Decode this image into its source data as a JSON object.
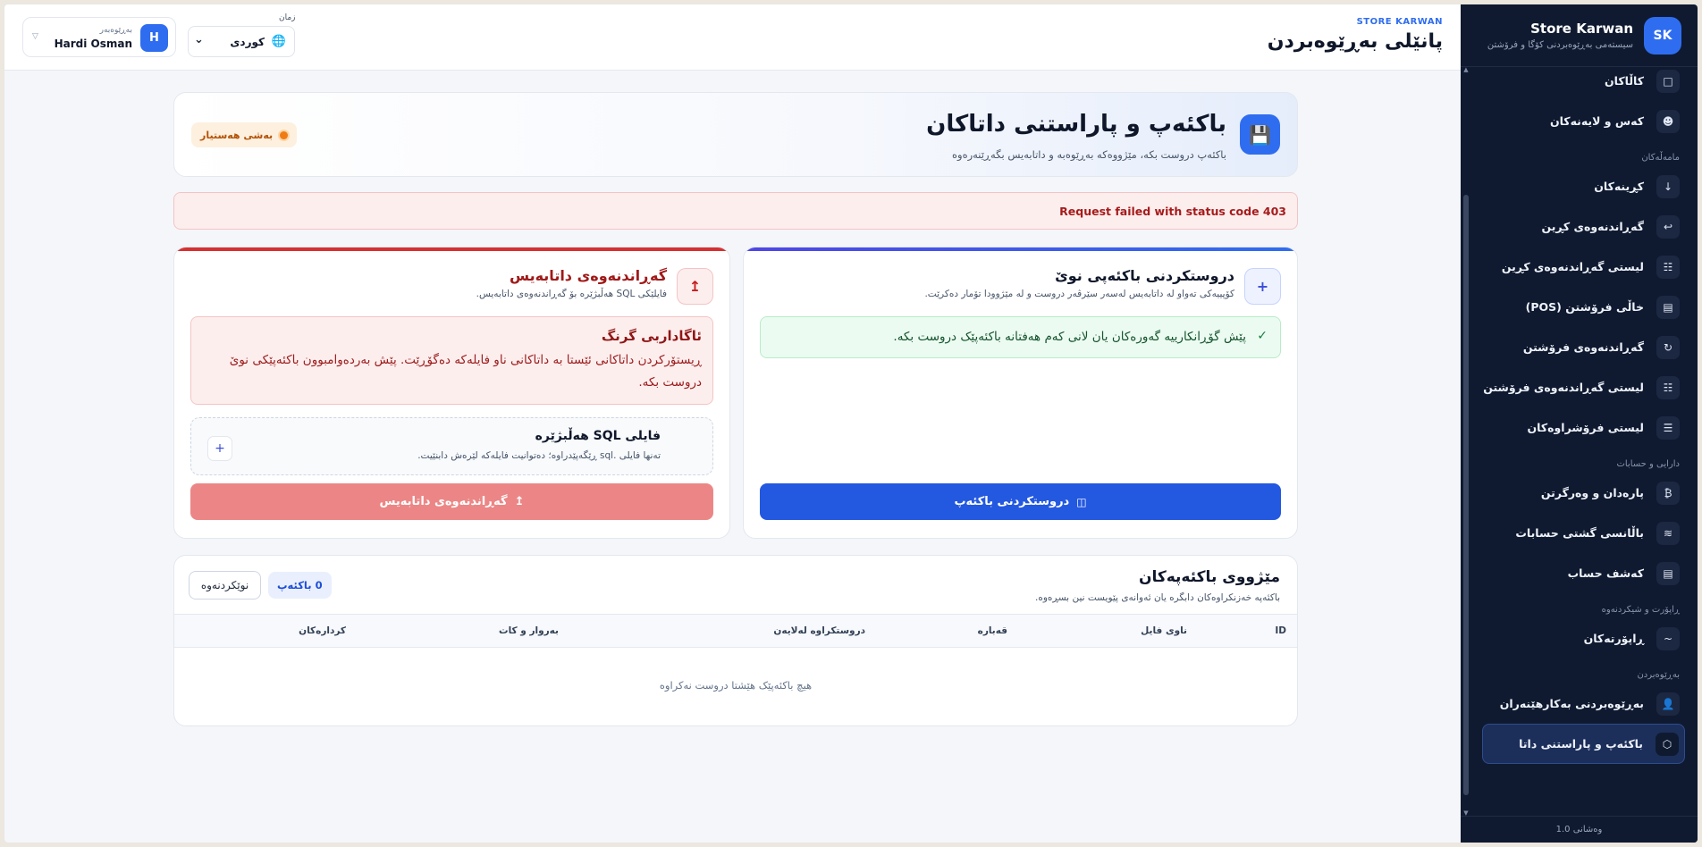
{
  "sidebar": {
    "logo": "SK",
    "brand": "Store Karwan",
    "brand_sub": "سیستەمی بەڕێوەبردنی کۆگا و فرۆشتن",
    "items_top": [
      {
        "label": "کاڵاکان",
        "icon": "□"
      },
      {
        "label": "کەس و لایەنەکان",
        "icon": "☻"
      }
    ],
    "section_trade": "مامەڵەکان",
    "items_trade": [
      {
        "label": "کڕینەکان",
        "icon": "↓"
      },
      {
        "label": "گەڕاندنەوەی کڕین",
        "icon": "↩"
      },
      {
        "label": "لیستی گەڕاندنەوەی کڕین",
        "icon": "☷"
      },
      {
        "label": "خاڵی فرۆشتن (POS)",
        "icon": "▤"
      },
      {
        "label": "گەڕاندنەوەی فرۆشتن",
        "icon": "↻"
      },
      {
        "label": "لیستی گەڕاندنەوەی فرۆشتن",
        "icon": "☷"
      },
      {
        "label": "لیستی فرۆشراوەکان",
        "icon": "☰"
      }
    ],
    "section_finance": "دارایی و حسابات",
    "items_finance": [
      {
        "label": "پارەدان و وەرگرتن",
        "icon": "₿"
      },
      {
        "label": "باڵانسی گشتی حسابات",
        "icon": "≋"
      },
      {
        "label": "کەشف حساب",
        "icon": "▤"
      }
    ],
    "section_reports": "ڕاپۆرت و شیکردنەوە",
    "items_reports": [
      {
        "label": "ڕاپۆرتەکان",
        "icon": "~"
      }
    ],
    "section_admin": "بەڕێوەبردن",
    "items_admin": [
      {
        "label": "بەڕێوەبردنی بەکارهێنەران",
        "icon": "👤"
      },
      {
        "label": "باکئەپ و پاراستنی داتا",
        "icon": "⬡"
      }
    ],
    "version": "وەشانی 1.0"
  },
  "topbar": {
    "kicker": "STORE KARWAN",
    "title": "پانێلی بەڕێوەبردن",
    "user_role": "بەڕێوەبەر",
    "user_name": "Hardi Osman",
    "user_initial": "H",
    "lang_label": "زمان",
    "lang_value": "کوردی"
  },
  "page": {
    "title": "باکئەپ و پاراستنی داتاکان",
    "subtitle": "باکئەپ دروست بکە، مێژووەکە بەڕێوەبە و داتابەیس بگەڕێنەرەوە",
    "badge": "بەشی هەستیار"
  },
  "alert": {
    "text": "Request failed with status code 403"
  },
  "create_card": {
    "icon": "+",
    "title": "دروستکردنی باکئەپی نوێ",
    "subtitle": "کۆپییەکی تەواو لە داتابەیس لەسەر سێرڤەر دروست و لە مێژوودا تۆمار دەکرێت.",
    "tip_check": "✓",
    "tip": "پێش گۆڕانکارییە گەورەکان یان لانی کەم هەفتانە باکئەپێک دروست بکە.",
    "button": "دروستکردنی باکئەپ",
    "button_icon": "◫"
  },
  "restore_card": {
    "icon": "↥",
    "title": "گەڕاندنەوەی داتابەیس",
    "subtitle": "فایلێکی SQL هەڵبژێرە بۆ گەڕاندنەوەی داتابەیس.",
    "warn_title": "ئاگاداربی گرنگ",
    "warn_text": "ڕیستۆرکردن داتاکانی ئێستا بە داتاکانی ناو فایلەکە دەگۆڕێت. پێش بەردەوامبوون باکئەپێکی نوێ دروست بکە.",
    "file_title": "فایلی SQL هەڵبژێرە",
    "file_sub": "تەنها فایلی .sql ڕێگەپێدراوە؛ دەتوانیت فایلەکە لێرەش دابنێیت.",
    "file_plus": "+",
    "button": "گەڕاندنەوەی داتابەیس",
    "button_icon": "↥"
  },
  "history": {
    "title": "مێژووی باکئەپەکان",
    "subtitle": "باکئەپە خەزنکراوەکان دابگرە یان ئەوانەی پێویست نین بسڕەوە.",
    "refresh": "نوێکردنەوە",
    "count": "0 باکئەپ",
    "columns": [
      "ID",
      "ناوی فایل",
      "قەبارە",
      "دروستکراوە لەلایەن",
      "بەروار و کات",
      "کردارەکان"
    ],
    "empty": "هیچ باکئەپێک هێشتا دروست نەکراوە"
  }
}
